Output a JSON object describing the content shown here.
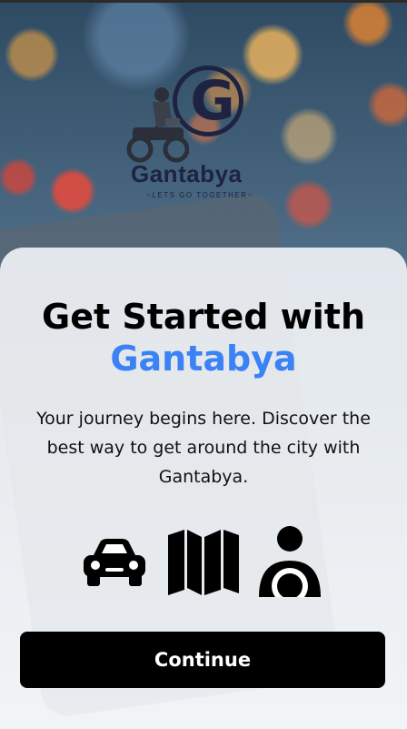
{
  "logo": {
    "letter": "G",
    "name": "Gantabya",
    "tagline": "~LETS GO TOGETHER~"
  },
  "heading": {
    "line1": "Get Started with",
    "line2": "Gantabya"
  },
  "description": "Your journey begins here. Discover the best way to get around the city with Gantabya.",
  "feature_icons": [
    "car-icon",
    "map-icon",
    "driver-icon"
  ],
  "continue_button": {
    "label": "Continue"
  },
  "colors": {
    "accent": "#3b82f6",
    "button": "#000000",
    "logo": "#1d2340"
  }
}
